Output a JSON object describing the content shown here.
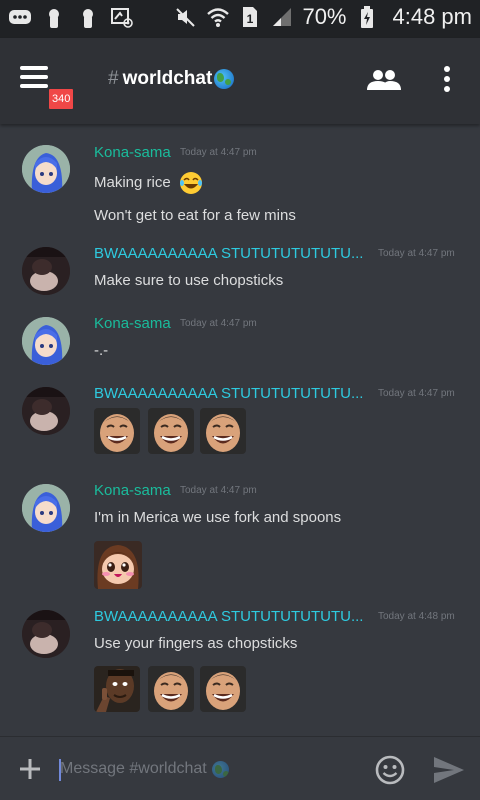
{
  "status_bar": {
    "battery_percent": "70%",
    "time": "4:48 pm",
    "sim_slot": "1",
    "icons": [
      "chat-bubble-icon",
      "keyhole-icon",
      "keyhole-icon",
      "screen-wifi-icon",
      "mute-icon",
      "wifi-icon",
      "sim-icon",
      "signal-icon",
      "battery-icon"
    ]
  },
  "header": {
    "unread_badge": "340",
    "channel_hash": "#",
    "channel_name": "worldchat"
  },
  "messages": [
    {
      "author": "Kona-sama",
      "timestamp": "Today at 4:47 pm",
      "lines": [
        "Making rice",
        "Won't get to eat for a few mins"
      ],
      "inline_emoji": "joy-emoji"
    },
    {
      "author": "BWAAAAAAAAAA STUTUTUTUTUTU...",
      "timestamp": "Today at 4:47 pm",
      "lines": [
        "Make sure to use chopsticks"
      ]
    },
    {
      "author": "Kona-sama",
      "timestamp": "Today at 4:47 pm",
      "lines": [
        "-.-"
      ]
    },
    {
      "author": "BWAAAAAAAAAA STUTUTUTUTUTU...",
      "timestamp": "Today at 4:47 pm",
      "lines": [],
      "custom_emojis": [
        "yao-ming-emoji",
        "yao-ming-emoji",
        "yao-ming-emoji"
      ]
    },
    {
      "author": "Kona-sama",
      "timestamp": "Today at 4:47 pm",
      "lines": [
        "I'm in Merica we use fork and spoons"
      ],
      "custom_emojis": [
        "anime-blush-emoji"
      ]
    },
    {
      "author": "BWAAAAAAAAAA STUTUTUTUTUTU...",
      "timestamp": "Today at 4:48 pm",
      "lines": [
        "Use your fingers as chopsticks"
      ],
      "custom_emojis": [
        "thinking-man-emoji",
        "yao-ming-emoji",
        "yao-ming-emoji"
      ]
    }
  ],
  "composer": {
    "placeholder": "Message #worldchat",
    "value": ""
  },
  "colors": {
    "background": "#36393f",
    "header": "#2f3136",
    "status_bar": "#202225",
    "kona_name": "#1abc9c",
    "bwa_name": "#2ecadf",
    "badge": "#f04747",
    "accent": "#7289da"
  }
}
